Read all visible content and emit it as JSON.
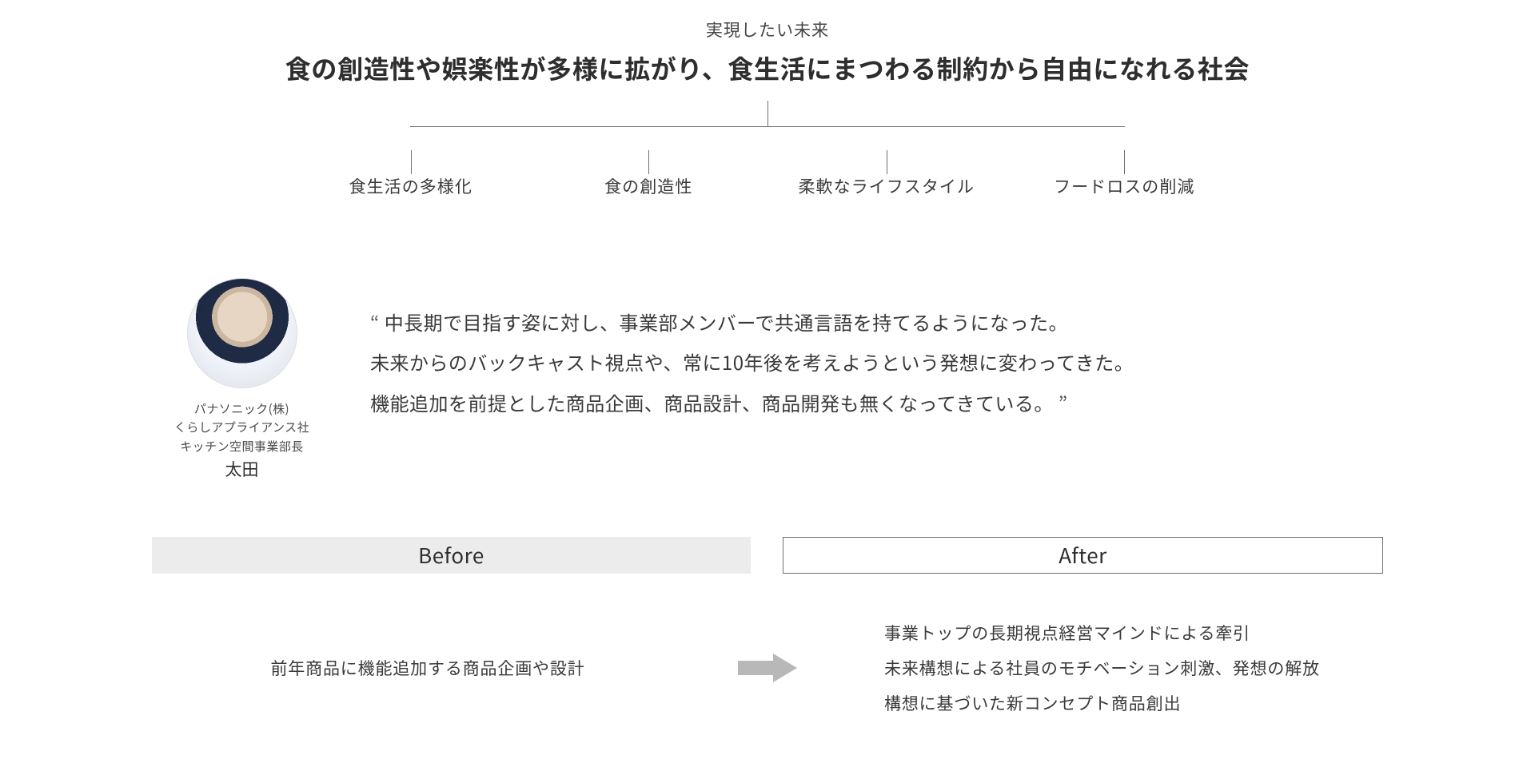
{
  "vision": {
    "label": "実現したい未来",
    "headline": "食の創造性や娯楽性が多様に拡がり、食生活にまつわる制約から自由になれる社会",
    "pillars": [
      "食生活の多様化",
      "食の創造性",
      "柔軟なライフスタイル",
      "フードロスの削減"
    ]
  },
  "profile": {
    "company": "パナソニック(株)",
    "org1": "くらしアプライアンス社",
    "org2": "キッチン空間事業部長",
    "name": "太田"
  },
  "quote": {
    "open": "“ ",
    "line1": "中長期で目指す姿に対し、事業部メンバーで共通言語を持てるようになった。",
    "line2": "未来からのバックキャスト視点や、常に10年後を考えようという発想に変わってきた。",
    "line3": "機能追加を前提とした商品企画、商品設計、商品開発も無くなってきている。",
    "close": " ”"
  },
  "before_after": {
    "before_label": "Before",
    "after_label": "After",
    "before_text": "前年商品に機能追加する商品企画や設計",
    "after_items": [
      "事業トップの長期視点経営マインドによる牽引",
      "未来構想による社員のモチベーション刺激、発想の解放",
      "構想に基づいた新コンセプト商品創出"
    ]
  }
}
